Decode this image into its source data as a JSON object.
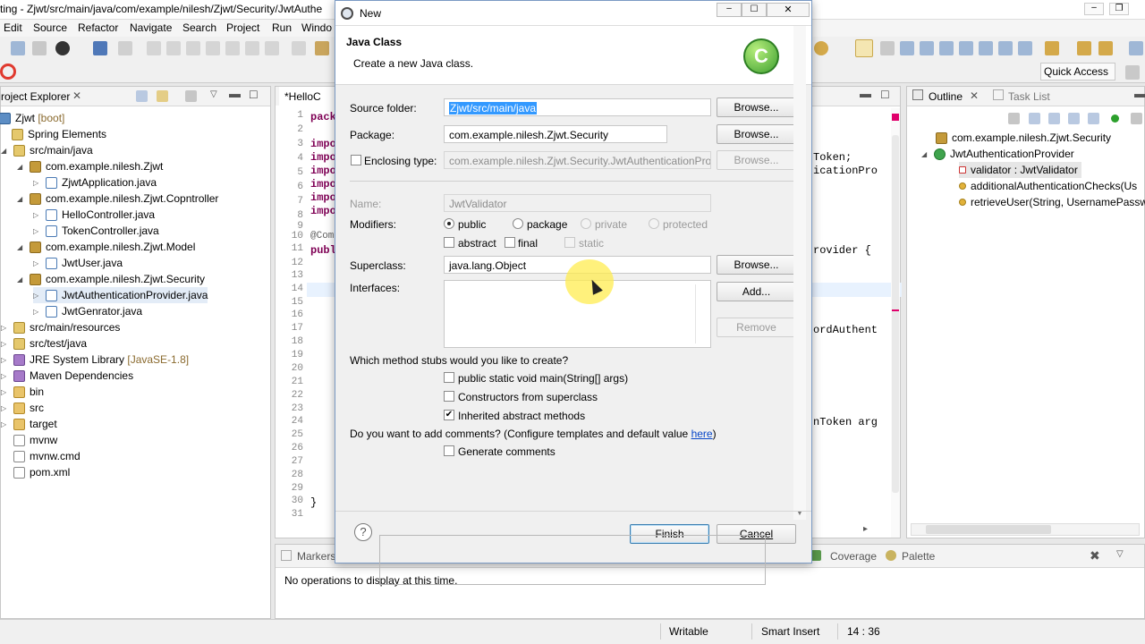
{
  "window": {
    "title": "ting - Zjwt/src/main/java/com/example/nilesh/Zjwt/Security/JwtAuthe"
  },
  "menu": [
    "Edit",
    "Source",
    "Refactor",
    "Navigate",
    "Search",
    "Project",
    "Run",
    "Windo"
  ],
  "quick_access": "Quick Access",
  "project_explorer": {
    "title": "roject Explorer",
    "items": [
      {
        "label": "Zjwt",
        "suffix": "[boot]"
      },
      {
        "label": "Spring Elements"
      },
      {
        "label": "src/main/java"
      },
      {
        "label": "com.example.nilesh.Zjwt"
      },
      {
        "label": "ZjwtApplication.java"
      },
      {
        "label": "com.example.nilesh.Zjwt.Copntroller"
      },
      {
        "label": "HelloController.java"
      },
      {
        "label": "TokenController.java"
      },
      {
        "label": "com.example.nilesh.Zjwt.Model"
      },
      {
        "label": "JwtUser.java"
      },
      {
        "label": "com.example.nilesh.Zjwt.Security"
      },
      {
        "label": "JwtAuthenticationProvider.java"
      },
      {
        "label": "JwtGenrator.java"
      },
      {
        "label": "src/main/resources"
      },
      {
        "label": "src/test/java"
      },
      {
        "label": "JRE System Library",
        "suffix": "[JavaSE-1.8]"
      },
      {
        "label": "Maven Dependencies"
      },
      {
        "label": "bin"
      },
      {
        "label": "src"
      },
      {
        "label": "target"
      },
      {
        "label": "mvnw"
      },
      {
        "label": "mvnw.cmd"
      },
      {
        "label": "pom.xml"
      }
    ]
  },
  "editor": {
    "tab": "*HelloC",
    "line_numbers": [
      "1",
      "2",
      "3",
      "4",
      "5",
      "6",
      "7",
      "8",
      "9",
      "10",
      "11",
      "12",
      "13",
      "14",
      "15",
      "16",
      "17",
      "18",
      "19",
      "20",
      "21",
      "22",
      "23",
      "24",
      "25",
      "26",
      "27",
      "28",
      "29",
      "30",
      "31"
    ],
    "left_fragments": [
      "pack",
      "impo",
      "impo",
      "impo",
      "impo",
      "impo",
      "impo",
      "@Com",
      "publ",
      "}"
    ],
    "right_fragments": [
      "Token;",
      "icationPro",
      "rovider {",
      "ordAuthent",
      "nToken arg"
    ]
  },
  "outline": {
    "tab": "Outline",
    "tab2": "Task List",
    "items": [
      "com.example.nilesh.Zjwt.Security",
      "JwtAuthenticationProvider",
      "validator : JwtValidator",
      "additionalAuthenticationChecks(Us",
      "retrieveUser(String, UsernamePassw"
    ]
  },
  "bottom": {
    "tab_markers": "Markers",
    "tab_coverage": "Coverage",
    "tab_palette": "Palette",
    "message": "No operations to display at this time."
  },
  "status": {
    "writable": "Writable",
    "insert": "Smart Insert",
    "position": "14 : 36"
  },
  "dialog": {
    "title": "New",
    "heading": "Java Class",
    "subtitle": "Create a new Java class.",
    "source_folder_label": "Source folder:",
    "source_folder_value": "Zjwt/src/main/java",
    "package_label": "Package:",
    "package_value": "com.example.nilesh.Zjwt.Security",
    "enclosing_label": "Enclosing type:",
    "enclosing_value": "com.example.nilesh.Zjwt.Security.JwtAuthenticationPro",
    "name_label": "Name:",
    "name_value": "JwtValidator",
    "modifiers_label": "Modifiers:",
    "mod_public": "public",
    "mod_package": "package",
    "mod_private": "private",
    "mod_protected": "protected",
    "mod_abstract": "abstract",
    "mod_final": "final",
    "mod_static": "static",
    "superclass_label": "Superclass:",
    "superclass_value": "java.lang.Object",
    "interfaces_label": "Interfaces:",
    "browse": "Browse...",
    "add": "Add...",
    "remove": "Remove",
    "stubs_question": "Which method stubs would you like to create?",
    "stub_main": "public static void main(String[] args)",
    "stub_ctor": "Constructors from superclass",
    "stub_inherited": "Inherited abstract methods",
    "comments_question": "Do you want to add comments? (Configure templates and default value ",
    "comments_link": "here",
    "comments_close": ")",
    "generate_comments": "Generate comments",
    "finish": "Finish",
    "cancel": "Cancel",
    "help": "?"
  }
}
